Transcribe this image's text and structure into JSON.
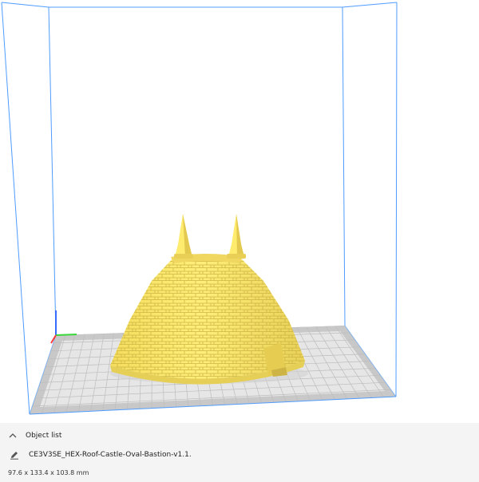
{
  "object_list": {
    "header_label": "Object list",
    "object_name": "CE3V3SE_HEX-Roof-Castle-Oval-Bastion-v1.1.",
    "dimensions": "97.6 x 133.4 x 103.8 mm"
  },
  "colors": {
    "model": "#ffec6e",
    "model_shade": "#d8c24a",
    "build_volume_edges": "#4f9cff",
    "build_plate": "#e2e2e2",
    "plate_border": "#c4c4c4",
    "grid_lines": "#bcbcbc",
    "axis_x": "#ff3a3a",
    "axis_y": "#3ad83a",
    "axis_z": "#3a6bff"
  },
  "icons": {
    "collapse": "chevron-up-icon",
    "edit": "pencil-icon"
  }
}
